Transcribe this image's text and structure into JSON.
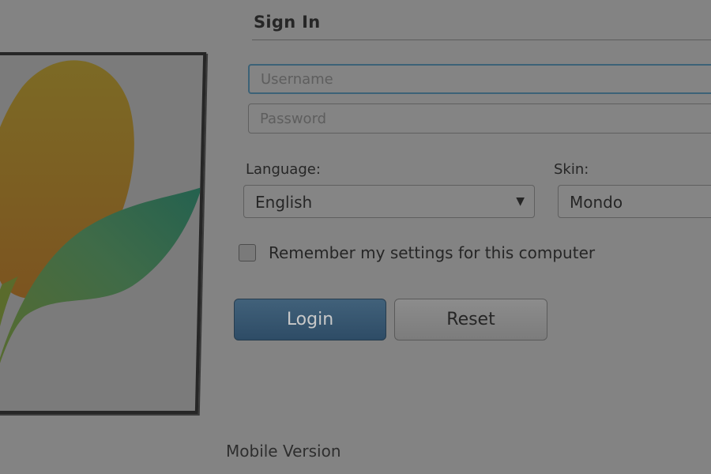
{
  "signin": {
    "title": "Sign In",
    "username_placeholder": "Username",
    "password_placeholder": "Password",
    "language_label": "Language:",
    "language_value": "English",
    "skin_label": "Skin:",
    "skin_value": "Mondo",
    "remember_label": "Remember my settings for this computer",
    "remember_checked": false,
    "login_label": "Login",
    "reset_label": "Reset",
    "mobile_link": "Mobile Version"
  },
  "icons": {
    "logo": "flower-logo-icon",
    "dropdown": "chevron-down-icon"
  },
  "colors": {
    "login_button": "#365570",
    "focus_border": "#3c6277",
    "background": "#838383"
  }
}
